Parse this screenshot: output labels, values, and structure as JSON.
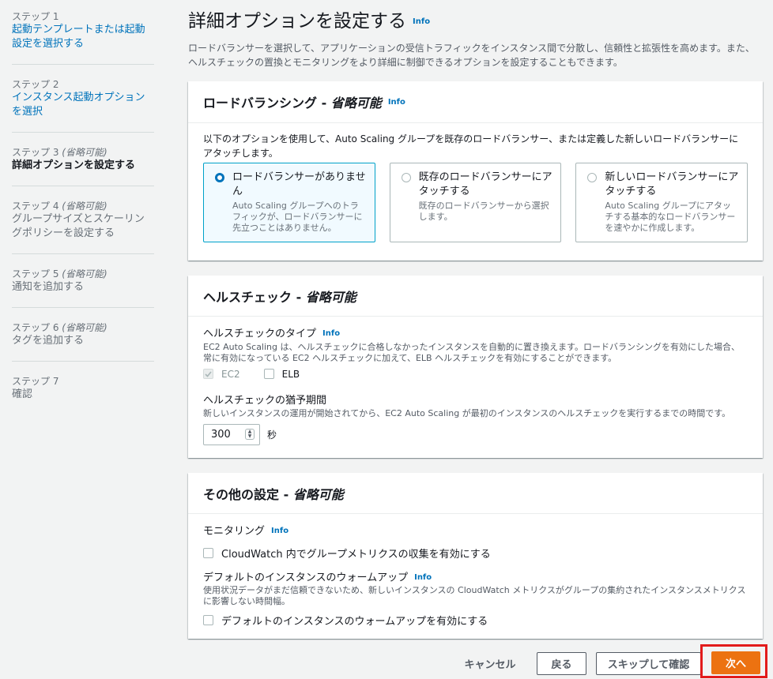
{
  "sidebar": {
    "steps": [
      {
        "num": "ステップ 1",
        "optional": "",
        "title": "起動テンプレートまたは起動設定を選択する",
        "state": "link"
      },
      {
        "num": "ステップ 2",
        "optional": "",
        "title": "インスタンス起動オプションを選択",
        "state": "link"
      },
      {
        "num": "ステップ 3",
        "optional": "(省略可能)",
        "title": "詳細オプションを設定する",
        "state": "active"
      },
      {
        "num": "ステップ 4",
        "optional": "(省略可能)",
        "title": "グループサイズとスケーリングポリシーを設定する",
        "state": "disabled"
      },
      {
        "num": "ステップ 5",
        "optional": "(省略可能)",
        "title": "通知を追加する",
        "state": "disabled"
      },
      {
        "num": "ステップ 6",
        "optional": "(省略可能)",
        "title": "タグを追加する",
        "state": "disabled"
      },
      {
        "num": "ステップ 7",
        "optional": "",
        "title": "確認",
        "state": "disabled"
      }
    ]
  },
  "header": {
    "title": "詳細オプションを設定する",
    "info": "Info",
    "description": "ロードバランサーを選択して、アプリケーションの受信トラフィックをインスタンス間で分散し、信頼性と拡張性を高めます。また、ヘルスチェックの置換とモニタリングをより詳細に制御できるオプションを設定することもできます。"
  },
  "load_balancing": {
    "title": "ロードバランシング - ",
    "title_optional": "省略可能",
    "info": "Info",
    "description": "以下のオプションを使用して、Auto Scaling グループを既存のロードバランサー、または定義した新しいロードバランサーにアタッチします。",
    "options": [
      {
        "title": "ロードバランサーがありません",
        "sub": "Auto Scaling グループへのトラフィックが、ロードバランサーに先立つことはありません。",
        "selected": true
      },
      {
        "title": "既存のロードバランサーにアタッチする",
        "sub": "既存のロードバランサーから選択します。",
        "selected": false
      },
      {
        "title": "新しいロードバランサーにアタッチする",
        "sub": "Auto Scaling グループにアタッチする基本的なロードバランサーを速やかに作成します。",
        "selected": false
      }
    ]
  },
  "health_check": {
    "title": "ヘルスチェック - ",
    "title_optional": "省略可能",
    "type_label": "ヘルスチェックのタイプ",
    "type_info": "Info",
    "type_desc": "EC2 Auto Scaling は、ヘルスチェックに合格しなかったインスタンスを自動的に置き換えます。ロードバランシングを有効にした場合、常に有効になっている EC2 ヘルスチェックに加えて、ELB ヘルスチェックを有効にすることができます。",
    "ec2_label": "EC2",
    "elb_label": "ELB",
    "grace_label": "ヘルスチェックの猶予期間",
    "grace_desc": "新しいインスタンスの運用が開始されてから、EC2 Auto Scaling が最初のインスタンスのヘルスチェックを実行するまでの時間です。",
    "grace_value": "300",
    "grace_unit": "秒"
  },
  "other": {
    "title": "その他の設定 - ",
    "title_optional": "省略可能",
    "monitoring_label": "モニタリング",
    "monitoring_info": "Info",
    "monitoring_cb": "CloudWatch 内でグループメトリクスの収集を有効にする",
    "warmup_label": "デフォルトのインスタンスのウォームアップ",
    "warmup_info": "Info",
    "warmup_desc": "使用状況データがまだ信頼できないため、新しいインスタンスの CloudWatch メトリクスがグループの集約されたインスタンスメトリクスに影響しない時間幅。",
    "warmup_cb": "デフォルトのインスタンスのウォームアップを有効にする"
  },
  "footer": {
    "cancel": "キャンセル",
    "back": "戻る",
    "skip": "スキップして確認",
    "next": "次へ"
  },
  "colors": {
    "primary": "#ec7211",
    "link": "#0073bb",
    "highlight": "#e21b1b"
  }
}
